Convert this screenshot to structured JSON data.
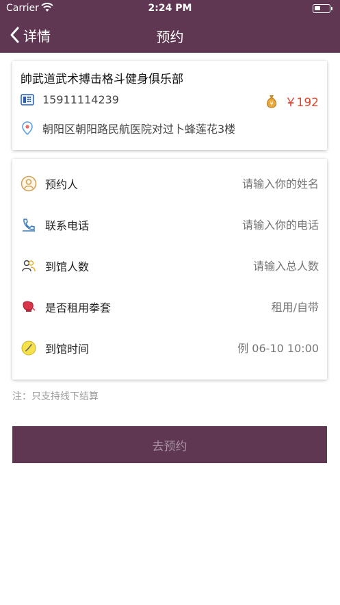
{
  "status_bar": {
    "carrier": "Carrier",
    "time": "2:24 PM"
  },
  "nav": {
    "back_label": "详情",
    "title": "预约"
  },
  "club": {
    "name": "帥武道武术搏击格斗健身俱乐部",
    "phone": "15911114239",
    "price": "￥192",
    "address": "朝阳区朝阳路民航医院对过卜蜂莲花3楼"
  },
  "form": {
    "rows": [
      {
        "label": "预约人",
        "placeholder": "请输入你的姓名",
        "icon": "person-icon"
      },
      {
        "label": "联系电话",
        "placeholder": "请输入你的电话",
        "icon": "phone-icon"
      },
      {
        "label": "到馆人数",
        "placeholder": "请输入总人数",
        "icon": "people-icon"
      },
      {
        "label": "是否租用拳套",
        "placeholder": "租用/自带",
        "icon": "boxing-glove-icon"
      },
      {
        "label": "到馆时间",
        "placeholder": "例 06-10 10:00",
        "icon": "clock-icon"
      }
    ]
  },
  "note": "注：只支持线下结算",
  "submit_label": "去预约",
  "colors": {
    "brand": "#5f3752",
    "price": "#e0452e",
    "placeholder": "#b9b9b9"
  }
}
